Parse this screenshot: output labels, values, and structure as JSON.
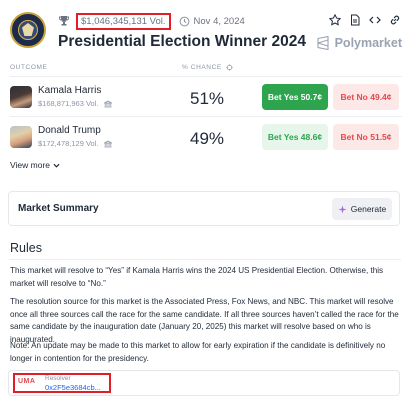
{
  "header": {
    "volume": "$1,046,345,131 Vol.",
    "date": "Nov 4, 2024",
    "title": "Presidential Election Winner 2024",
    "brand": "Polymarket",
    "icons": [
      "trophy-icon",
      "clock-icon",
      "star-icon",
      "file-icon",
      "code-icon",
      "link-icon",
      "polymarket-logo-icon"
    ]
  },
  "outcomes_header": {
    "outcome": "OUTCOME",
    "chance": "% CHANCE"
  },
  "outcomes": [
    {
      "name": "Kamala Harris",
      "volume": "$168,871,963 Vol.",
      "chance": "51%",
      "yes_label": "Bet Yes 50.7¢",
      "no_label": "Bet No 49.4¢"
    },
    {
      "name": "Donald Trump",
      "volume": "$172,478,129 Vol.",
      "chance": "49%",
      "yes_label": "Bet Yes 48.6¢",
      "no_label": "Bet No 51.5¢"
    }
  ],
  "view_more": "View more",
  "summary": {
    "title": "Market Summary",
    "generate_label": "Generate"
  },
  "rules": {
    "title": "Rules",
    "paragraphs": [
      "This market will resolve to “Yes” if Kamala Harris wins the 2024 US Presidential Election. Otherwise, this market will resolve to “No.”",
      "The resolution source for this market is the Associated Press, Fox News, and NBC. This market will resolve once all three sources call the race for the same candidate. If all three sources haven’t called the race for the same candidate by the inauguration date (January 20, 2025) this market will resolve based on who is inaugurated.",
      "Note: An update may be made to this market to allow for early expiration if the candidate is definitively no longer in contention for the presidency."
    ]
  },
  "resolver": {
    "logo_text": "UMA",
    "label": "Resolver",
    "address": "0x2F5e3684cb..."
  },
  "colors": {
    "yes_green": "#2ea44f",
    "no_red": "#e5484d",
    "highlight_red": "#e11d2a",
    "link_blue": "#2563eb"
  }
}
